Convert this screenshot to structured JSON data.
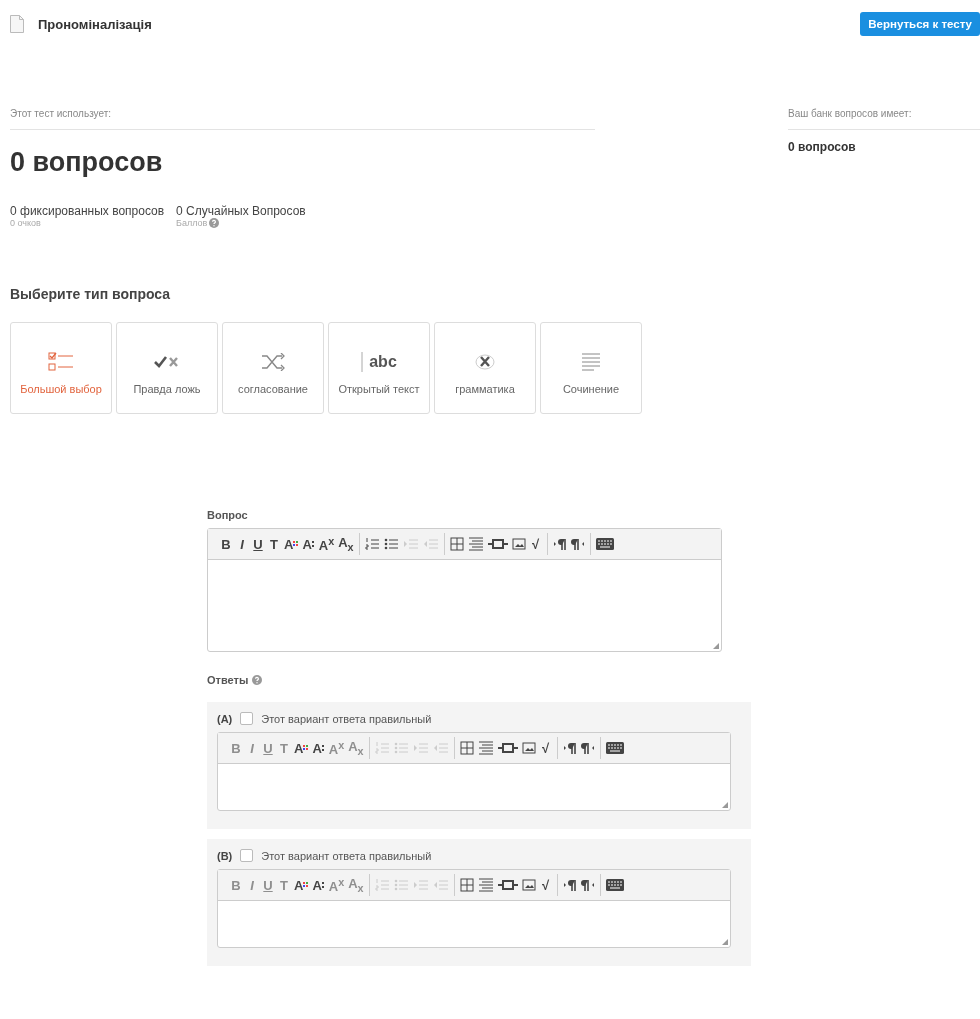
{
  "header": {
    "title": "Прономіналізація",
    "back_button": "Вернуться к тесту"
  },
  "test_summary": {
    "label": "Этот тест использует:",
    "total": "0 вопросов",
    "fixed": {
      "count": "0 фиксированных вопросов",
      "points": "0 очков"
    },
    "random": {
      "count": "0 Случайных Вопросов",
      "points": "Баллов"
    }
  },
  "bank_summary": {
    "label": "Ваш банк вопросов имеет:",
    "total": "0 вопросов"
  },
  "question_types": {
    "title": "Выберите тип вопроса",
    "items": [
      {
        "kind": "multiple_choice",
        "label": "Большой выбор",
        "selected": true
      },
      {
        "kind": "true_false",
        "label": "Правда ложь",
        "selected": false
      },
      {
        "kind": "matching",
        "label": "согласование",
        "selected": false
      },
      {
        "kind": "open_text",
        "label": "Открытый текст",
        "icon_text": "abc",
        "selected": false
      },
      {
        "kind": "grammar",
        "label": "грамматика",
        "selected": false
      },
      {
        "kind": "essay",
        "label": "Сочинение",
        "selected": false
      }
    ]
  },
  "question": {
    "label": "Вопрос",
    "toolbar": [
      [
        {
          "kind": "bold",
          "label": "B",
          "disabled": false
        },
        {
          "kind": "italic",
          "label": "I",
          "disabled": false
        },
        {
          "kind": "underline",
          "label": "U",
          "disabled": false
        },
        {
          "kind": "strike",
          "label": "T",
          "disabled": false
        },
        {
          "kind": "color",
          "label": "A",
          "disabled": false
        },
        {
          "kind": "size",
          "label": "A",
          "disabled": false
        },
        {
          "kind": "sup",
          "label": "A$^{x}$",
          "disabled": false
        },
        {
          "kind": "sub",
          "label": "A$_{x}$",
          "disabled": false
        }
      ],
      [
        {
          "kind": "ol",
          "disabled": false
        },
        {
          "kind": "ul",
          "disabled": false
        },
        {
          "kind": "indent",
          "disabled": true
        },
        {
          "kind": "outdent",
          "disabled": true
        }
      ],
      [
        {
          "kind": "table",
          "disabled": false
        },
        {
          "kind": "align",
          "disabled": false
        },
        {
          "kind": "link",
          "disabled": false
        },
        {
          "kind": "image",
          "disabled": false
        },
        {
          "kind": "sqrt",
          "label": "√",
          "disabled": false
        }
      ],
      [
        {
          "kind": "ltr",
          "disabled": false
        },
        {
          "kind": "rtl",
          "disabled": false
        }
      ],
      [
        {
          "kind": "keyboard",
          "disabled": false
        }
      ]
    ]
  },
  "answers": {
    "label": "Ответы",
    "items": [
      {
        "letter": "(A)",
        "correct_label": "Этот вариант ответа правильный",
        "checked": false,
        "toolbar": [
          [
            {
              "kind": "bold",
              "label": "B",
              "disabled": true
            },
            {
              "kind": "italic",
              "label": "I",
              "disabled": true
            },
            {
              "kind": "underline",
              "label": "U",
              "disabled": true
            },
            {
              "kind": "strike",
              "label": "T",
              "disabled": true
            },
            {
              "kind": "color",
              "label": "A",
              "disabled": false
            },
            {
              "kind": "size",
              "label": "A",
              "disabled": false
            },
            {
              "kind": "sup",
              "label": "A$^{x}$",
              "disabled": true
            },
            {
              "kind": "sub",
              "label": "A$_{x}$",
              "disabled": true
            }
          ],
          [
            {
              "kind": "ol",
              "disabled": true
            },
            {
              "kind": "ul",
              "disabled": true
            },
            {
              "kind": "indent",
              "disabled": true
            },
            {
              "kind": "outdent",
              "disabled": true
            }
          ],
          [
            {
              "kind": "table",
              "disabled": false
            },
            {
              "kind": "align",
              "disabled": false
            },
            {
              "kind": "link",
              "disabled": false
            },
            {
              "kind": "image",
              "disabled": false
            },
            {
              "kind": "sqrt",
              "label": "√",
              "disabled": false
            }
          ],
          [
            {
              "kind": "ltr",
              "disabled": false
            },
            {
              "kind": "rtl",
              "disabled": false
            }
          ],
          [
            {
              "kind": "keyboard",
              "disabled": false
            }
          ]
        ]
      },
      {
        "letter": "(B)",
        "correct_label": "Этот вариант ответа правильный",
        "checked": false,
        "toolbar": [
          [
            {
              "kind": "bold",
              "label": "B",
              "disabled": true
            },
            {
              "kind": "italic",
              "label": "I",
              "disabled": true
            },
            {
              "kind": "underline",
              "label": "U",
              "disabled": true
            },
            {
              "kind": "strike",
              "label": "T",
              "disabled": true
            },
            {
              "kind": "color",
              "label": "A",
              "disabled": false
            },
            {
              "kind": "size",
              "label": "A",
              "disabled": false
            },
            {
              "kind": "sup",
              "label": "A$^{x}$",
              "disabled": true
            },
            {
              "kind": "sub",
              "label": "A$_{x}$",
              "disabled": true
            }
          ],
          [
            {
              "kind": "ol",
              "disabled": true
            },
            {
              "kind": "ul",
              "disabled": true
            },
            {
              "kind": "indent",
              "disabled": true
            },
            {
              "kind": "outdent",
              "disabled": true
            }
          ],
          [
            {
              "kind": "table",
              "disabled": false
            },
            {
              "kind": "align",
              "disabled": false
            },
            {
              "kind": "link",
              "disabled": false
            },
            {
              "kind": "image",
              "disabled": false
            },
            {
              "kind": "sqrt",
              "label": "√",
              "disabled": false
            }
          ],
          [
            {
              "kind": "ltr",
              "disabled": false
            },
            {
              "kind": "rtl",
              "disabled": false
            }
          ],
          [
            {
              "kind": "keyboard",
              "disabled": false
            }
          ]
        ]
      }
    ]
  }
}
